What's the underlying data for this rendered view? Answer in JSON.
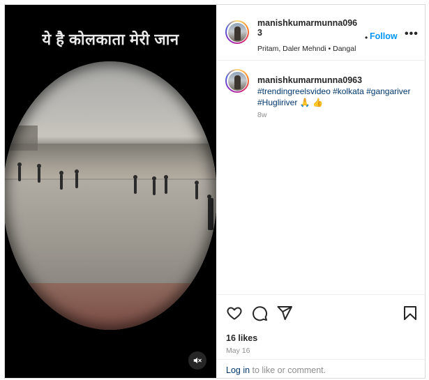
{
  "video": {
    "overlay_text": "ये है कोलकाता मेरी जान",
    "mute_icon": "speaker-muted-icon"
  },
  "header": {
    "username_line1": "manishkumarmunna096",
    "username_line2": "3",
    "dot": "•",
    "follow_label": "Follow",
    "more_label": "•••",
    "audio": "Pritam, Daler Mehndi • Dangal"
  },
  "caption": {
    "username": "manishkumarmunna0963",
    "text": "#trendingreelsvideo #kolkata #gangariver #Hugliriver 🙏 👍",
    "time": "8w"
  },
  "actions": {
    "like_icon": "heart-icon",
    "comment_icon": "comment-icon",
    "share_icon": "share-icon",
    "save_icon": "bookmark-icon"
  },
  "stats": {
    "likes": "16 likes",
    "date": "May 16"
  },
  "login": {
    "link": "Log in",
    "text": " to like or comment."
  },
  "colors": {
    "follow_blue": "#0095f6",
    "link_blue": "#00376b",
    "muted_gray": "#8e8e8e",
    "border": "#dbdbdb"
  }
}
